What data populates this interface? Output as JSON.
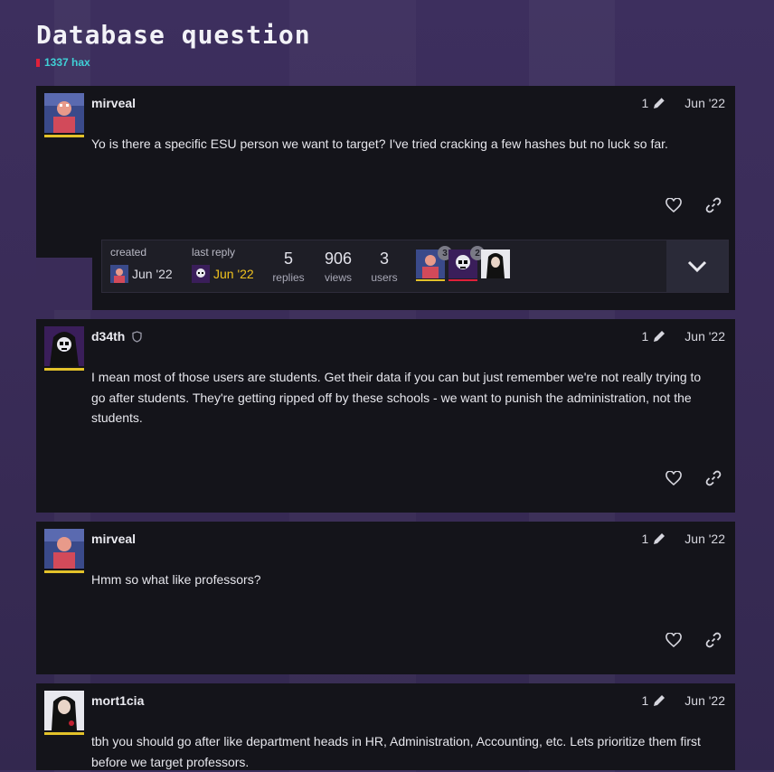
{
  "topic": {
    "title": "Database question",
    "category": "1337 hax",
    "category_color": "#e0203a"
  },
  "topic_map": {
    "created_label": "created",
    "created_date": "Jun '22",
    "last_reply_label": "last reply",
    "last_reply_date": "Jun '22",
    "replies_value": "5",
    "replies_label": "replies",
    "views_value": "906",
    "views_label": "views",
    "users_value": "3",
    "users_label": "users",
    "participants": [
      {
        "name": "mirveal",
        "count": "3",
        "icon": "avatar-mirveal"
      },
      {
        "name": "d34th",
        "count": "2",
        "icon": "avatar-d34th"
      },
      {
        "name": "mort1cia",
        "count": "",
        "icon": "avatar-mort1cia"
      }
    ]
  },
  "posts": [
    {
      "username": "mirveal",
      "edits": "1",
      "date": "Jun '22",
      "body": "Yo is there a specific ESU person we want to target? I've tried cracking a few hashes but no luck so far."
    },
    {
      "username": "d34th",
      "edits": "1",
      "date": "Jun '22",
      "body": "I mean most of those users are students. Get their data if you can but just remember we're not really trying to go after students. They're getting ripped off by these schools - we want to punish the administration, not the students."
    },
    {
      "username": "mirveal",
      "edits": "1",
      "date": "Jun '22",
      "body": "Hmm so what like professors?"
    },
    {
      "username": "mort1cia",
      "edits": "1",
      "date": "Jun '22",
      "body": "tbh you should go after like department heads in HR, Administration, Accounting, etc. Lets prioritize them first before we target professors."
    }
  ],
  "colors": {
    "accent": "#f0c21e",
    "flair": "#e3c22a",
    "category_text": "#3fd0d6",
    "post_bg": "#14141a"
  }
}
